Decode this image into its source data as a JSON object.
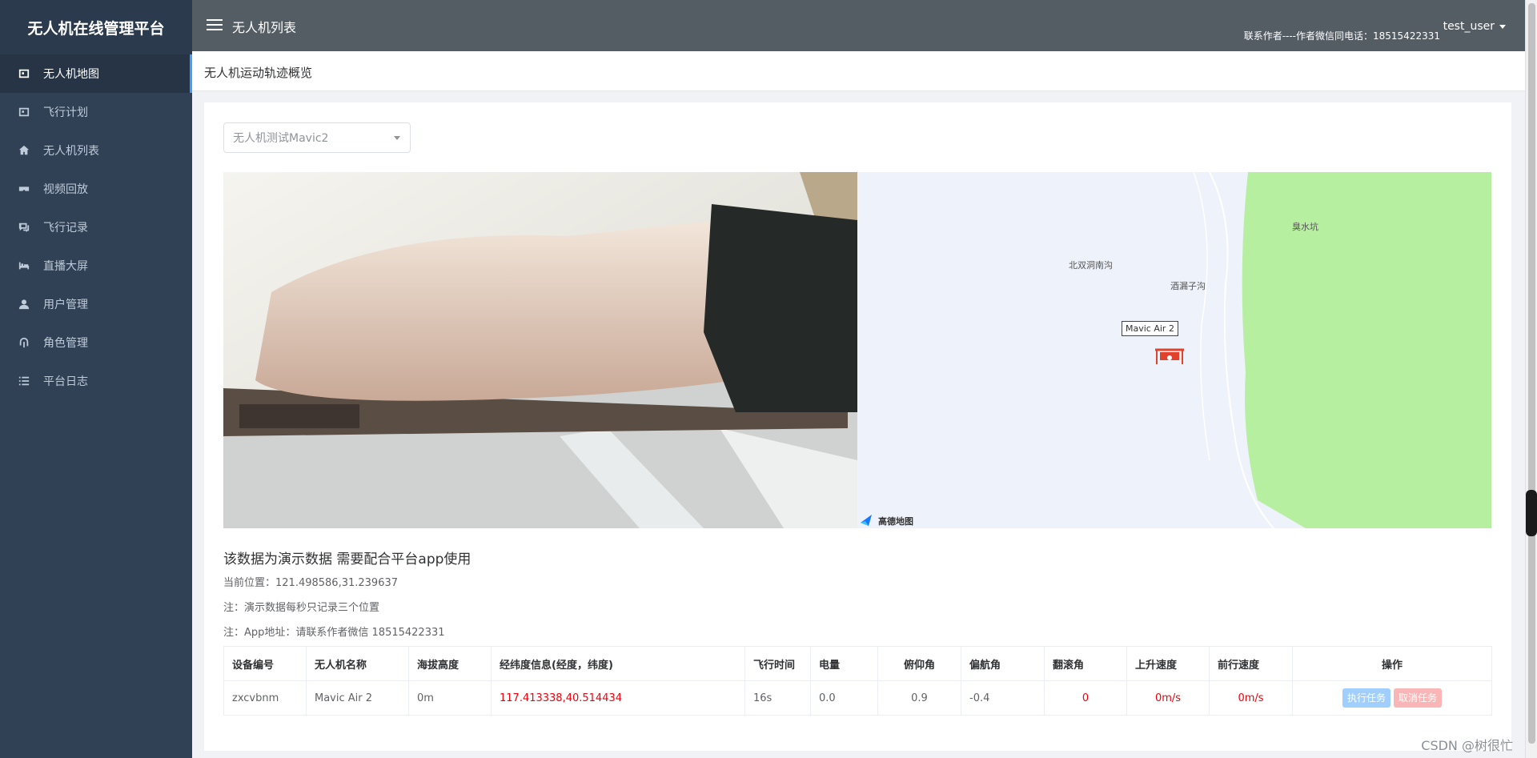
{
  "app": {
    "brand": "无人机在线管理平台"
  },
  "sidebar": {
    "items": [
      {
        "label": "无人机地图",
        "icon": "map-icon"
      },
      {
        "label": "飞行计划",
        "icon": "plan-icon"
      },
      {
        "label": "无人机列表",
        "icon": "home-icon"
      },
      {
        "label": "视频回放",
        "icon": "vr-icon"
      },
      {
        "label": "飞行记录",
        "icon": "comment-icon"
      },
      {
        "label": "直播大屏",
        "icon": "bed-icon"
      },
      {
        "label": "用户管理",
        "icon": "user-icon"
      },
      {
        "label": "角色管理",
        "icon": "fingerprint-icon"
      },
      {
        "label": "平台日志",
        "icon": "list-icon"
      }
    ],
    "active_index": 0
  },
  "header": {
    "title": "无人机列表",
    "contact": "联系作者----作者微信同电话：18515422331",
    "user": "test_user"
  },
  "page": {
    "title": "无人机运动轨迹概览"
  },
  "select": {
    "value": "无人机测试Mavic2"
  },
  "map": {
    "labels": [
      "北双洞南沟",
      "酒漏子沟",
      "臭水坑"
    ],
    "marker_label": "Mavic Air 2",
    "attribution": "高德地图"
  },
  "notice": {
    "headline": "该数据为演示数据 需要配合平台app使用",
    "position": "当前位置：121.498586,31.239637",
    "note1": "注：演示数据每秒只记录三个位置",
    "note2": "注：App地址：请联系作者微信 18515422331"
  },
  "table": {
    "headers": [
      "设备编号",
      "无人机名称",
      "海拔高度",
      "经纬度信息(经度，纬度)",
      "飞行时间",
      "电量",
      "俯仰角",
      "偏航角",
      "翻滚角",
      "上升速度",
      "前行速度",
      "操作"
    ],
    "rows": [
      [
        "zxcvbnm",
        "Mavic Air 2",
        "0m",
        "117.413338,40.514434",
        "16s",
        "0.0",
        "0.9",
        "-0.4",
        "0",
        "0m/s",
        "0m/s"
      ]
    ],
    "actions": {
      "run": "执行任务",
      "cancel": "取消任务"
    }
  },
  "watermark": "CSDN @树很忙",
  "colors": {
    "sidebar": "#304156",
    "header": "#545c64",
    "accent": "#409eff",
    "danger": "#f0000b"
  }
}
